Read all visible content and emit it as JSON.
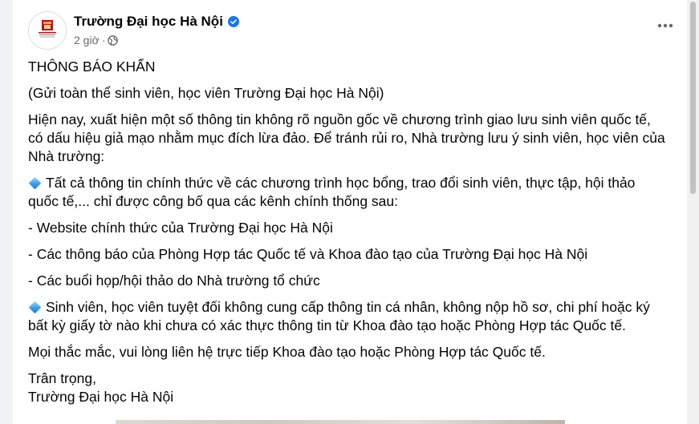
{
  "post": {
    "page_name": "Trường Đại học Hà Nội",
    "time": "2 giờ",
    "separator": "·",
    "verified_icon": "verified-badge-icon",
    "privacy_icon": "globe-icon",
    "more_icon": "more-horizontal-icon"
  },
  "content": {
    "lines": [
      "THÔNG BÁO KHẨN",
      "(Gửi toàn thể sinh viên, học viên Trường Đại học Hà Nội)",
      "Hiện nay, xuất hiện một số thông tin không rõ nguồn gốc về chương trình giao lưu sinh viên quốc tế,",
      "có dấu hiệu giả mạo nhằm mục đích lừa đảo. Để tránh rủi ro, Nhà trường lưu ý sinh viên, học viên của",
      "Nhà trường:",
      "Tất cả thông tin chính thức về các chương trình học bổng, trao đổi sinh viên, thực tập, hội thảo",
      "quốc tế,... chỉ được công bố qua các kênh chính thống sau:",
      "- Website chính thức của Trường Đại học Hà Nội",
      "- Các thông báo của Phòng Hợp tác Quốc tế và Khoa đào tạo của Trường Đại học Hà Nội",
      "- Các buổi họp/hội thảo do Nhà trường tổ chức",
      "Sinh viên, học viên tuyệt đối không cung cấp thông tin cá nhân, không nộp hồ sơ, chi phí hoặc ký",
      "bất kỳ giấy tờ nào khi chưa có xác thực thông tin từ Khoa đào tạo hoặc Phòng Hợp tác Quốc tế.",
      "Mọi thắc mắc, vui lòng liên hệ trực tiếp Khoa đào tạo hoặc Phòng Hợp tác Quốc tế.",
      "Trân trọng,",
      "Trường Đại học Hà Nội"
    ],
    "bullet_icon": "blue-diamond-icon"
  },
  "colors": {
    "text": "#050505",
    "meta": "#65676b",
    "verified": "#1877f2",
    "bullet": "#3b9cf0",
    "logo_red": "#b3141c"
  }
}
